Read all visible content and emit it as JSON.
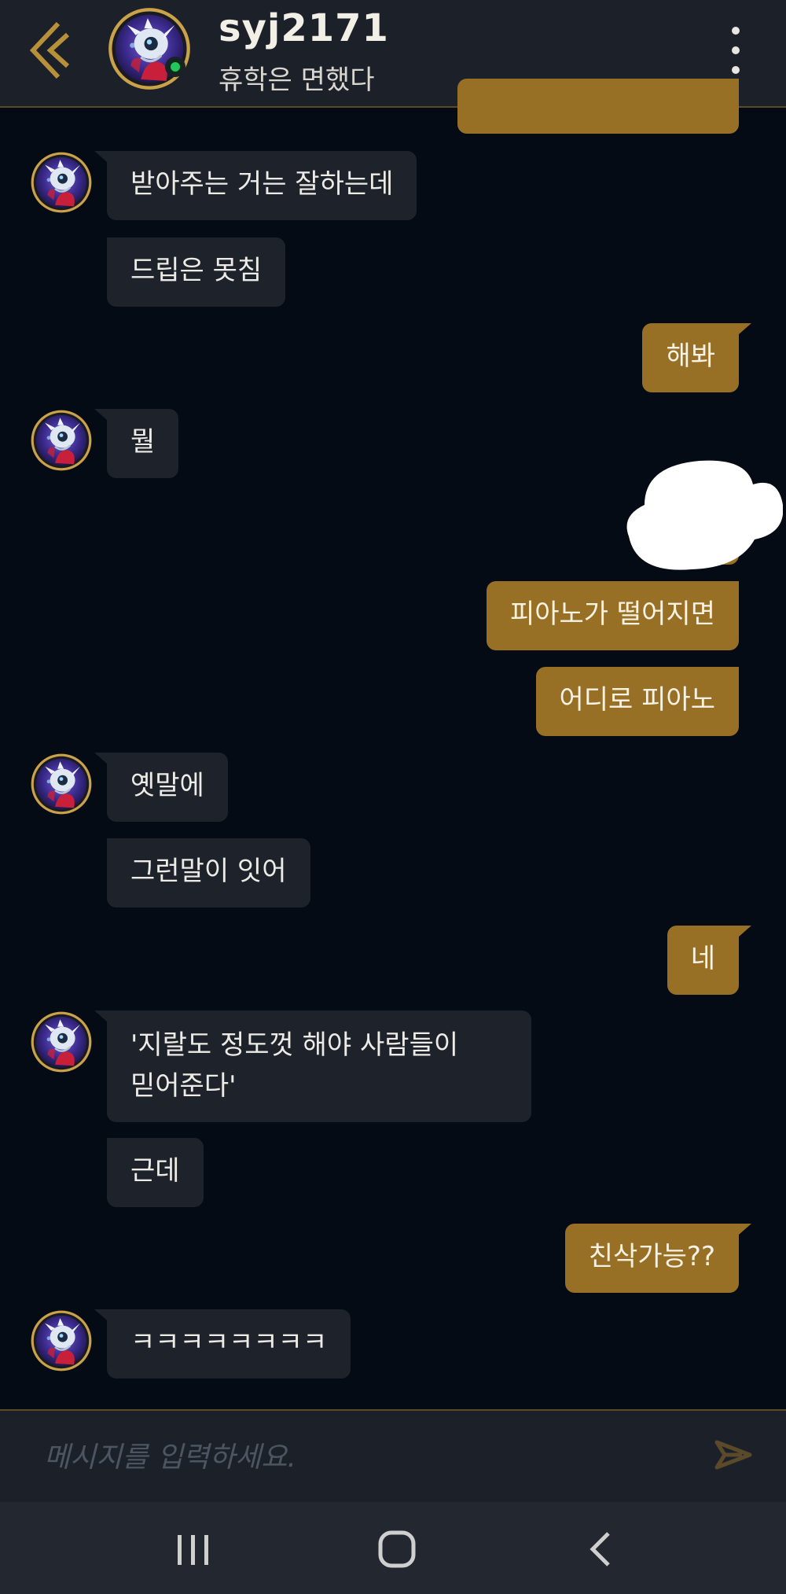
{
  "header": {
    "username": "syj2171",
    "status": "휴학은 면했다"
  },
  "messages": [
    {
      "side": "out",
      "text": "",
      "partial": true
    },
    {
      "side": "in",
      "text": "받아주는 거는 잘하는데"
    },
    {
      "side": "in",
      "text": "드립은 못침"
    },
    {
      "side": "out",
      "text": "해봐"
    },
    {
      "side": "in",
      "text": "뭘"
    },
    {
      "side": "out",
      "text": "",
      "obscured": true
    },
    {
      "side": "out",
      "text": "피아노가 떨어지면"
    },
    {
      "side": "out",
      "text": "어디로 피아노"
    },
    {
      "side": "in",
      "text": "옛말에"
    },
    {
      "side": "in",
      "text": "그런말이 잇어"
    },
    {
      "side": "out",
      "text": "네"
    },
    {
      "side": "in",
      "lines": [
        "'지랄도 정도껏 해야 사람들이",
        "믿어준다'"
      ]
    },
    {
      "side": "in",
      "text": "근데"
    },
    {
      "side": "out",
      "text": "친삭가능??"
    },
    {
      "side": "in",
      "text": "ㅋㅋㅋㅋㅋㅋㅋㅋ"
    }
  ],
  "input": {
    "placeholder": "메시지를 입력하세요.",
    "value": ""
  },
  "icons": {
    "back": "chevron-left-icon",
    "menu": "more-vertical-icon",
    "send": "send-icon",
    "nav_recent": "recent-apps-icon",
    "nav_home": "home-icon",
    "nav_back": "back-icon"
  },
  "colors": {
    "accent": "#987025",
    "background": "#050b14",
    "incoming_bubble": "#1e232b",
    "online": "#22c55e"
  }
}
